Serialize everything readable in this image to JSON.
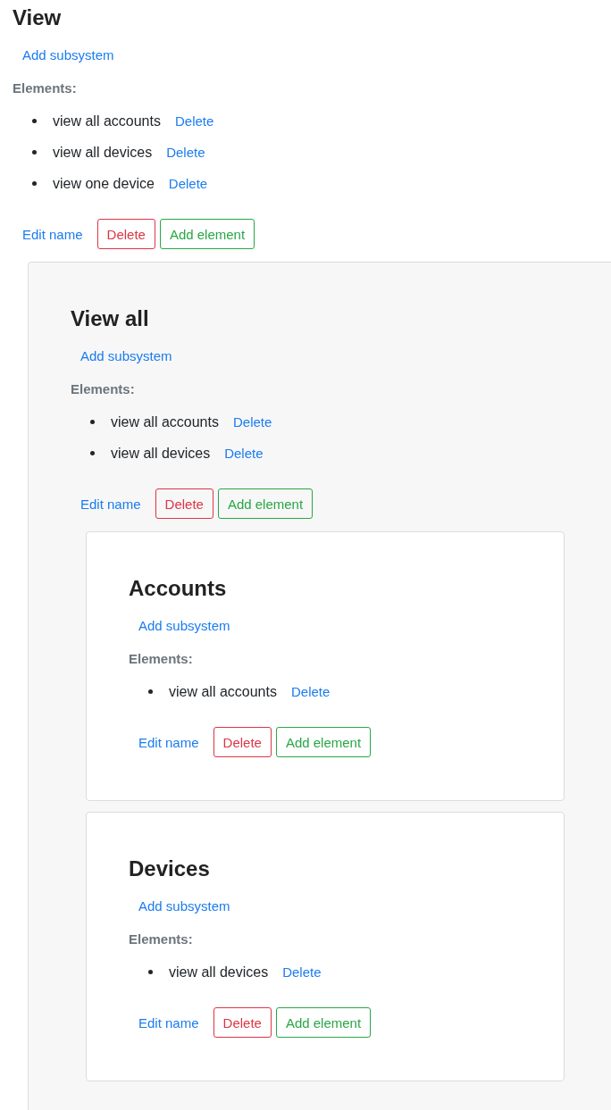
{
  "subsystem": {
    "title": "View",
    "add_subsystem": "Add subsystem",
    "elements_label": "Elements:",
    "elements": [
      {
        "name": "view all accounts",
        "delete": "Delete"
      },
      {
        "name": "view all devices",
        "delete": "Delete"
      },
      {
        "name": "view one device",
        "delete": "Delete"
      }
    ],
    "actions": {
      "edit": "Edit name",
      "delete": "Delete",
      "add_element": "Add element"
    },
    "subsystems": [
      {
        "title": "View all",
        "add_subsystem": "Add subsystem",
        "elements_label": "Elements:",
        "elements": [
          {
            "name": "view all accounts",
            "delete": "Delete"
          },
          {
            "name": "view all devices",
            "delete": "Delete"
          }
        ],
        "actions": {
          "edit": "Edit name",
          "delete": "Delete",
          "add_element": "Add element"
        },
        "subsystems": [
          {
            "title": "Accounts",
            "add_subsystem": "Add subsystem",
            "elements_label": "Elements:",
            "elements": [
              {
                "name": "view all accounts",
                "delete": "Delete"
              }
            ],
            "actions": {
              "edit": "Edit name",
              "delete": "Delete",
              "add_element": "Add element"
            }
          },
          {
            "title": "Devices",
            "add_subsystem": "Add subsystem",
            "elements_label": "Elements:",
            "elements": [
              {
                "name": "view all devices",
                "delete": "Delete"
              }
            ],
            "actions": {
              "edit": "Edit name",
              "delete": "Delete",
              "add_element": "Add element"
            }
          }
        ]
      }
    ]
  }
}
